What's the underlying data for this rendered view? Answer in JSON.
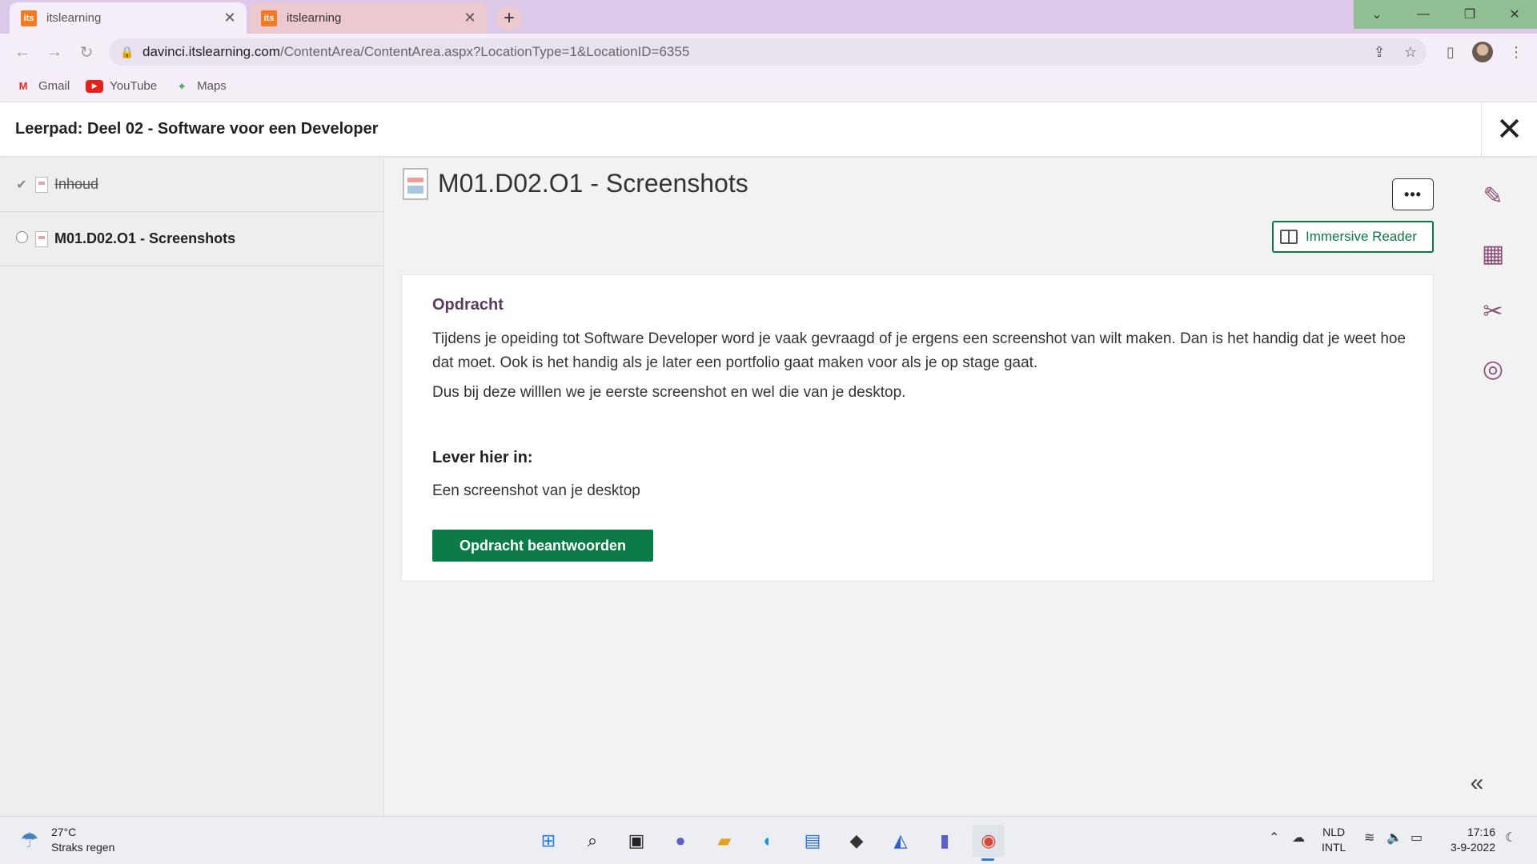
{
  "browser": {
    "tabs": [
      {
        "label": "itslearning",
        "favicon": "its",
        "active": true
      },
      {
        "label": "itslearning",
        "favicon": "its",
        "active": false
      }
    ],
    "url_host": "davinci.itslearning.com",
    "url_path": "/ContentArea/ContentArea.aspx?LocationType=1&LocationID=6355",
    "bookmarks": [
      {
        "label": "Gmail",
        "icon": "gmail-icon"
      },
      {
        "label": "YouTube",
        "icon": "youtube-icon"
      },
      {
        "label": "Maps",
        "icon": "maps-icon"
      }
    ]
  },
  "header": {
    "title": "Leerpad: Deel 02 - Software voor een Developer",
    "close_icon": "close-icon"
  },
  "sidebar": {
    "items": [
      {
        "label": "Inhoud",
        "status": "completed"
      },
      {
        "label": "M01.D02.O1 - Screenshots",
        "status": "current"
      }
    ]
  },
  "main": {
    "title": "M01.D02.O1 - Screenshots",
    "more_label": "•••",
    "immersive_label": "Immersive Reader",
    "section1_heading": "Opdracht",
    "para1": "Tijdens je opeiding tot Software Developer word je vaak gevraagd of je ergens een screenshot van wilt maken. Dan is het handig dat je weet hoe dat moet. Ook is het handig als je later een portfolio gaat maken voor als je op stage gaat.",
    "para2": "Dus bij deze willlen we je eerste screenshot en wel die van je desktop.",
    "section2_heading": "Lever hier in:",
    "para3": "Een screenshot van je desktop",
    "answer_button": "Opdracht beantwoorden"
  },
  "rail": {
    "icons": [
      "pencil-icon",
      "calendar-icon",
      "tools-icon",
      "target-icon"
    ],
    "collapse_icon": "double-chevron-left-icon"
  },
  "taskbar": {
    "weather_temp": "27°C",
    "weather_desc": "Straks regen",
    "lang_top": "NLD",
    "lang_bottom": "INTL",
    "time": "17:16",
    "date": "3-9-2022"
  },
  "colors": {
    "accent_green": "#0c7a46",
    "heading_purple": "#5a3b5c",
    "rail_icon": "#8c4e78",
    "titlebar": "#dcc8e9"
  }
}
